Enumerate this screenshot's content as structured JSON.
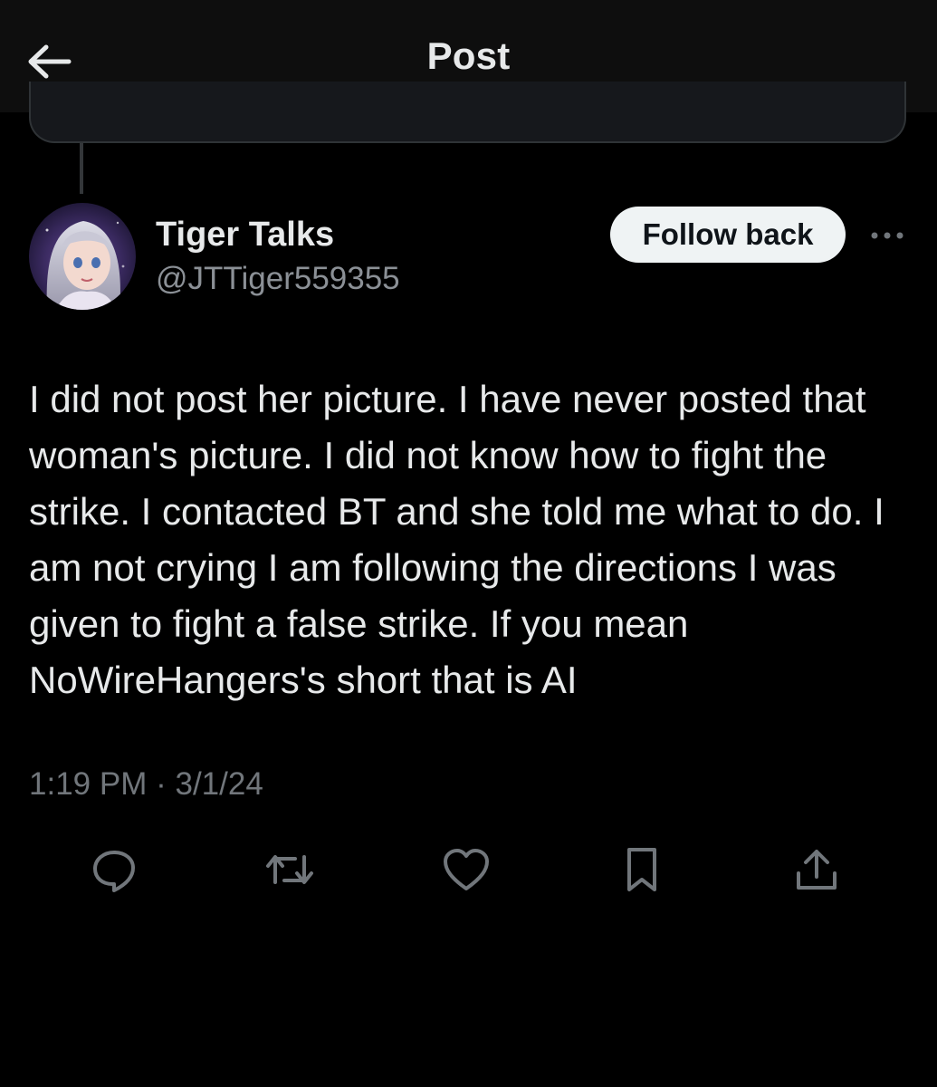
{
  "header": {
    "title": "Post",
    "back_icon": "arrow-left-icon"
  },
  "author": {
    "display_name": "Tiger Talks",
    "handle": "@JTTiger559355",
    "avatar": "avatar-image",
    "follow_label": "Follow back",
    "more_icon": "more-dots-icon"
  },
  "post": {
    "text": "I did not post her picture. I have never posted that woman's picture. I did not know how to fight the strike. I contacted BT and she told me what to do. I am not crying I am following the directions I was given to fight a false strike. If you mean NoWireHangers's short that is AI",
    "time": "1:19 PM",
    "separator": "·",
    "date": "3/1/24"
  },
  "actions": [
    {
      "name": "reply",
      "icon": "reply-icon"
    },
    {
      "name": "repost",
      "icon": "repost-icon"
    },
    {
      "name": "like",
      "icon": "heart-icon"
    },
    {
      "name": "bookmark",
      "icon": "bookmark-icon"
    },
    {
      "name": "share",
      "icon": "share-icon"
    }
  ],
  "colors": {
    "background": "#000000",
    "topbar": "#0e0e0e",
    "text": "#e7e9ea",
    "muted": "#71767b",
    "button_bg": "#eff3f4"
  }
}
